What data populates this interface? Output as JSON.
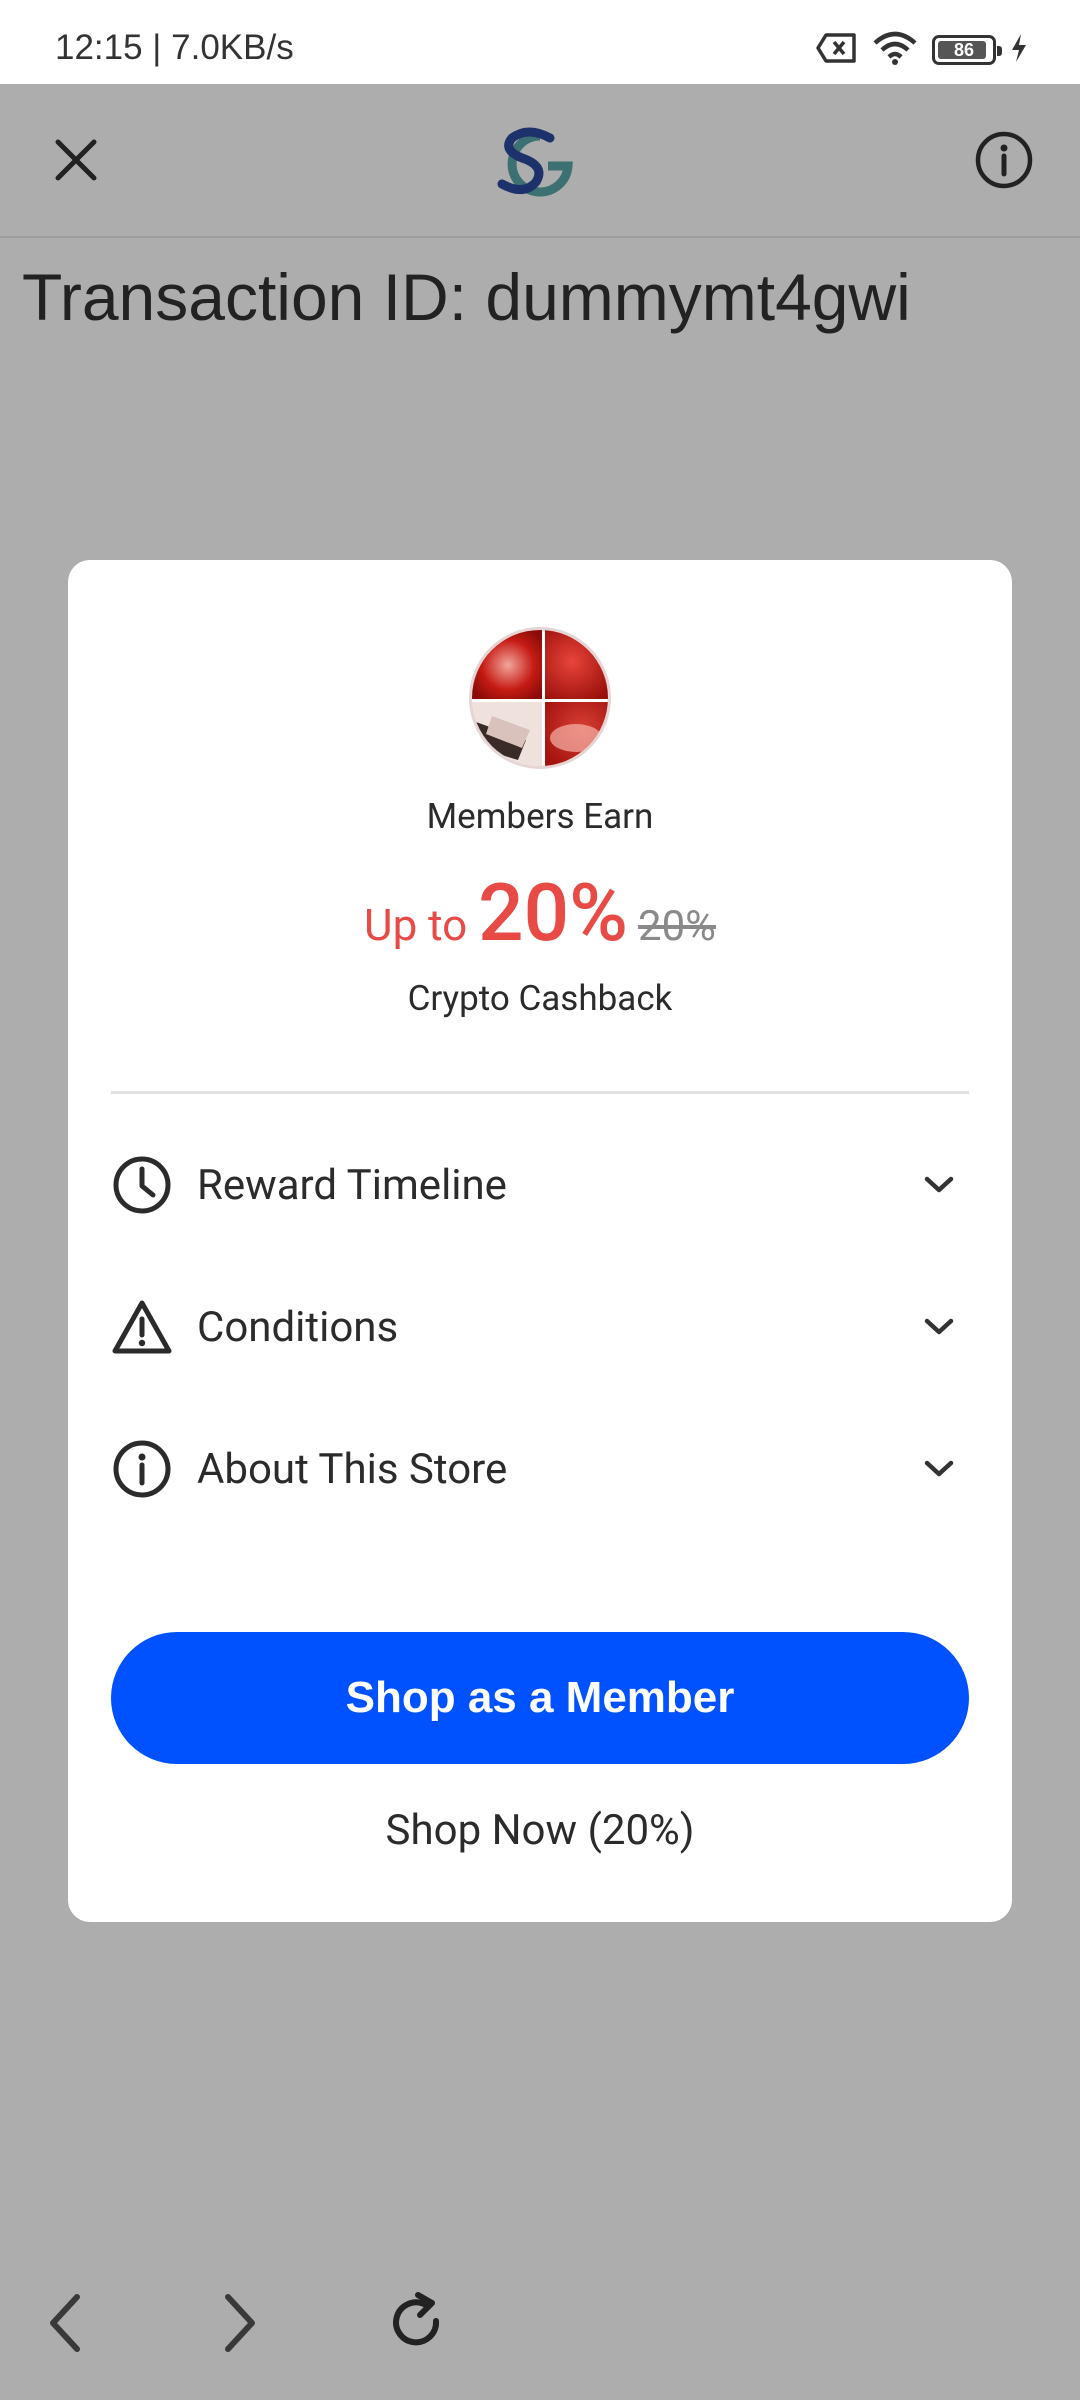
{
  "status_bar": {
    "time_speed": "12:15 | 7.0KB/s",
    "battery_level": "86"
  },
  "header": {
    "logo_icon": "sg-logo",
    "close_icon": "close-icon",
    "info_icon": "info-icon"
  },
  "transaction": {
    "label": "Transaction ID: dummymt4gwi"
  },
  "modal": {
    "members_earn": "Members Earn",
    "rate_prefix": "Up to ",
    "rate_value": "20%",
    "rate_old": "20%",
    "cashback_label": "Crypto Cashback",
    "accordion": [
      {
        "label": "Reward Timeline",
        "icon": "clock-icon"
      },
      {
        "label": "Conditions",
        "icon": "warning-icon"
      },
      {
        "label": "About This Store",
        "icon": "info-icon"
      }
    ],
    "primary_button": "Shop as a Member",
    "secondary_button": "Shop Now (20%)"
  },
  "bottom_nav": {
    "back_icon": "chevron-left-icon",
    "forward_icon": "chevron-right-icon",
    "reload_icon": "reload-icon"
  },
  "colors": {
    "accent_red": "#e84a45",
    "primary_blue": "#0051ff",
    "overlay": "rgba(0,0,0,0.32)"
  }
}
